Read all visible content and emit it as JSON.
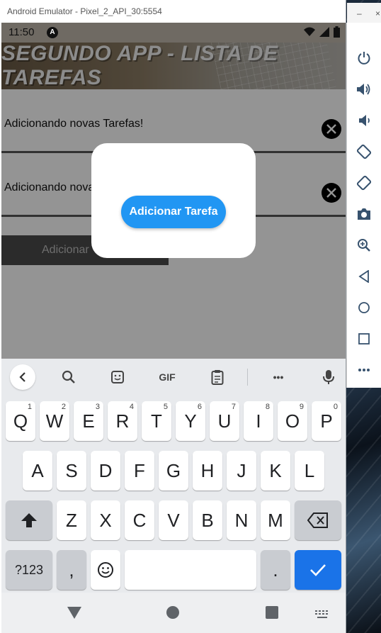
{
  "window": {
    "title": "Android Emulator - Pixel_2_API_30:5554",
    "minimize_icon": "minimize-icon",
    "close_icon": "close-icon"
  },
  "status_bar": {
    "time": "11:50",
    "icons": [
      "a-icon",
      "wifi-icon",
      "signal-icon",
      "battery-icon"
    ]
  },
  "app": {
    "header_title": "SEGUNDO APP - LISTA DE TAREFAS",
    "tasks": [
      {
        "text": "Adicionando novas Tarefas!"
      },
      {
        "text": "Adicionando nova"
      }
    ],
    "add_bar_label": "Adicionar",
    "modal": {
      "button_label": "Adicionar Tarefa"
    }
  },
  "keyboard": {
    "toolbar": [
      "back-icon",
      "search-icon",
      "sticker-icon",
      "GIF",
      "clipboard-icon",
      "more-icon",
      "mic-icon"
    ],
    "gif_label": "GIF",
    "more_label": "•••",
    "row1": [
      {
        "key": "Q",
        "hint": "1"
      },
      {
        "key": "W",
        "hint": "2"
      },
      {
        "key": "E",
        "hint": "3"
      },
      {
        "key": "R",
        "hint": "4"
      },
      {
        "key": "T",
        "hint": "5"
      },
      {
        "key": "Y",
        "hint": "6"
      },
      {
        "key": "U",
        "hint": "7"
      },
      {
        "key": "I",
        "hint": "8"
      },
      {
        "key": "O",
        "hint": "9"
      },
      {
        "key": "P",
        "hint": "0"
      }
    ],
    "row2": [
      "A",
      "S",
      "D",
      "F",
      "G",
      "H",
      "J",
      "K",
      "L"
    ],
    "row3": [
      "Z",
      "X",
      "C",
      "V",
      "B",
      "N",
      "M"
    ],
    "row4": {
      "symbols": "?123",
      "comma": ",",
      "period": "."
    }
  },
  "colors": {
    "accent": "#2196f3",
    "enter": "#1a73e8"
  }
}
